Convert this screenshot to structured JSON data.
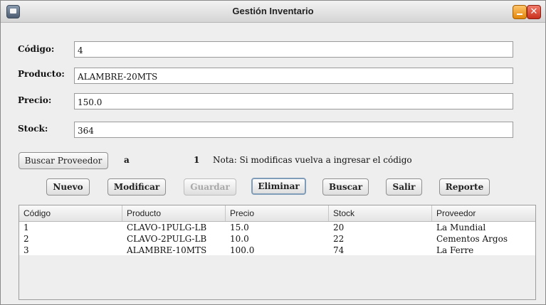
{
  "window": {
    "title": "Gestión Inventario"
  },
  "form": {
    "codigo": {
      "label": "Código:",
      "value": "4"
    },
    "producto": {
      "label": "Producto:",
      "value": "ALAMBRE-20MTS"
    },
    "precio": {
      "label": "Precio:",
      "value": "150.0"
    },
    "stock": {
      "label": "Stock:",
      "value": "364"
    }
  },
  "proveedor": {
    "button": "Buscar Proveedor",
    "name": "a",
    "id": "1",
    "note": "Nota: Si modificas vuelva a ingresar el código"
  },
  "actions": {
    "nuevo": "Nuevo",
    "modificar": "Modificar",
    "guardar": "Guardar",
    "eliminar": "Eliminar",
    "buscar": "Buscar",
    "salir": "Salir",
    "reporte": "Reporte"
  },
  "table": {
    "columns": [
      "Código",
      "Producto",
      "Precio",
      "Stock",
      "Proveedor"
    ],
    "rows": [
      [
        "1",
        "CLAVO-1PULG-LB",
        "15.0",
        "20",
        "La Mundial"
      ],
      [
        "2",
        "CLAVO-2PULG-LB",
        "10.0",
        "22",
        "Cementos Argos"
      ],
      [
        "3",
        "ALAMBRE-10MTS",
        "100.0",
        "74",
        "La Ferre"
      ]
    ]
  }
}
